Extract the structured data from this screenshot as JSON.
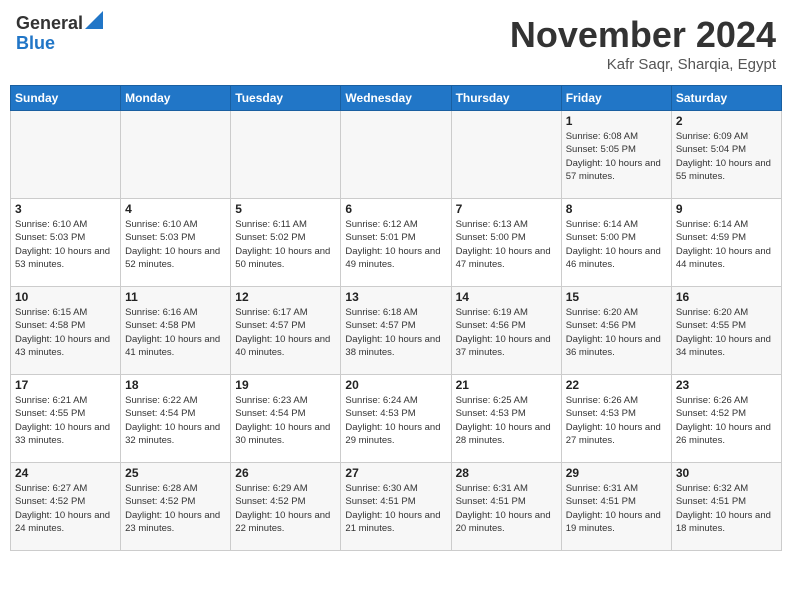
{
  "header": {
    "logo_general": "General",
    "logo_blue": "Blue",
    "month": "November 2024",
    "location": "Kafr Saqr, Sharqia, Egypt"
  },
  "days_of_week": [
    "Sunday",
    "Monday",
    "Tuesday",
    "Wednesday",
    "Thursday",
    "Friday",
    "Saturday"
  ],
  "weeks": [
    [
      {
        "day": "",
        "info": ""
      },
      {
        "day": "",
        "info": ""
      },
      {
        "day": "",
        "info": ""
      },
      {
        "day": "",
        "info": ""
      },
      {
        "day": "",
        "info": ""
      },
      {
        "day": "1",
        "info": "Sunrise: 6:08 AM\nSunset: 5:05 PM\nDaylight: 10 hours and 57 minutes."
      },
      {
        "day": "2",
        "info": "Sunrise: 6:09 AM\nSunset: 5:04 PM\nDaylight: 10 hours and 55 minutes."
      }
    ],
    [
      {
        "day": "3",
        "info": "Sunrise: 6:10 AM\nSunset: 5:03 PM\nDaylight: 10 hours and 53 minutes."
      },
      {
        "day": "4",
        "info": "Sunrise: 6:10 AM\nSunset: 5:03 PM\nDaylight: 10 hours and 52 minutes."
      },
      {
        "day": "5",
        "info": "Sunrise: 6:11 AM\nSunset: 5:02 PM\nDaylight: 10 hours and 50 minutes."
      },
      {
        "day": "6",
        "info": "Sunrise: 6:12 AM\nSunset: 5:01 PM\nDaylight: 10 hours and 49 minutes."
      },
      {
        "day": "7",
        "info": "Sunrise: 6:13 AM\nSunset: 5:00 PM\nDaylight: 10 hours and 47 minutes."
      },
      {
        "day": "8",
        "info": "Sunrise: 6:14 AM\nSunset: 5:00 PM\nDaylight: 10 hours and 46 minutes."
      },
      {
        "day": "9",
        "info": "Sunrise: 6:14 AM\nSunset: 4:59 PM\nDaylight: 10 hours and 44 minutes."
      }
    ],
    [
      {
        "day": "10",
        "info": "Sunrise: 6:15 AM\nSunset: 4:58 PM\nDaylight: 10 hours and 43 minutes."
      },
      {
        "day": "11",
        "info": "Sunrise: 6:16 AM\nSunset: 4:58 PM\nDaylight: 10 hours and 41 minutes."
      },
      {
        "day": "12",
        "info": "Sunrise: 6:17 AM\nSunset: 4:57 PM\nDaylight: 10 hours and 40 minutes."
      },
      {
        "day": "13",
        "info": "Sunrise: 6:18 AM\nSunset: 4:57 PM\nDaylight: 10 hours and 38 minutes."
      },
      {
        "day": "14",
        "info": "Sunrise: 6:19 AM\nSunset: 4:56 PM\nDaylight: 10 hours and 37 minutes."
      },
      {
        "day": "15",
        "info": "Sunrise: 6:20 AM\nSunset: 4:56 PM\nDaylight: 10 hours and 36 minutes."
      },
      {
        "day": "16",
        "info": "Sunrise: 6:20 AM\nSunset: 4:55 PM\nDaylight: 10 hours and 34 minutes."
      }
    ],
    [
      {
        "day": "17",
        "info": "Sunrise: 6:21 AM\nSunset: 4:55 PM\nDaylight: 10 hours and 33 minutes."
      },
      {
        "day": "18",
        "info": "Sunrise: 6:22 AM\nSunset: 4:54 PM\nDaylight: 10 hours and 32 minutes."
      },
      {
        "day": "19",
        "info": "Sunrise: 6:23 AM\nSunset: 4:54 PM\nDaylight: 10 hours and 30 minutes."
      },
      {
        "day": "20",
        "info": "Sunrise: 6:24 AM\nSunset: 4:53 PM\nDaylight: 10 hours and 29 minutes."
      },
      {
        "day": "21",
        "info": "Sunrise: 6:25 AM\nSunset: 4:53 PM\nDaylight: 10 hours and 28 minutes."
      },
      {
        "day": "22",
        "info": "Sunrise: 6:26 AM\nSunset: 4:53 PM\nDaylight: 10 hours and 27 minutes."
      },
      {
        "day": "23",
        "info": "Sunrise: 6:26 AM\nSunset: 4:52 PM\nDaylight: 10 hours and 26 minutes."
      }
    ],
    [
      {
        "day": "24",
        "info": "Sunrise: 6:27 AM\nSunset: 4:52 PM\nDaylight: 10 hours and 24 minutes."
      },
      {
        "day": "25",
        "info": "Sunrise: 6:28 AM\nSunset: 4:52 PM\nDaylight: 10 hours and 23 minutes."
      },
      {
        "day": "26",
        "info": "Sunrise: 6:29 AM\nSunset: 4:52 PM\nDaylight: 10 hours and 22 minutes."
      },
      {
        "day": "27",
        "info": "Sunrise: 6:30 AM\nSunset: 4:51 PM\nDaylight: 10 hours and 21 minutes."
      },
      {
        "day": "28",
        "info": "Sunrise: 6:31 AM\nSunset: 4:51 PM\nDaylight: 10 hours and 20 minutes."
      },
      {
        "day": "29",
        "info": "Sunrise: 6:31 AM\nSunset: 4:51 PM\nDaylight: 10 hours and 19 minutes."
      },
      {
        "day": "30",
        "info": "Sunrise: 6:32 AM\nSunset: 4:51 PM\nDaylight: 10 hours and 18 minutes."
      }
    ]
  ]
}
